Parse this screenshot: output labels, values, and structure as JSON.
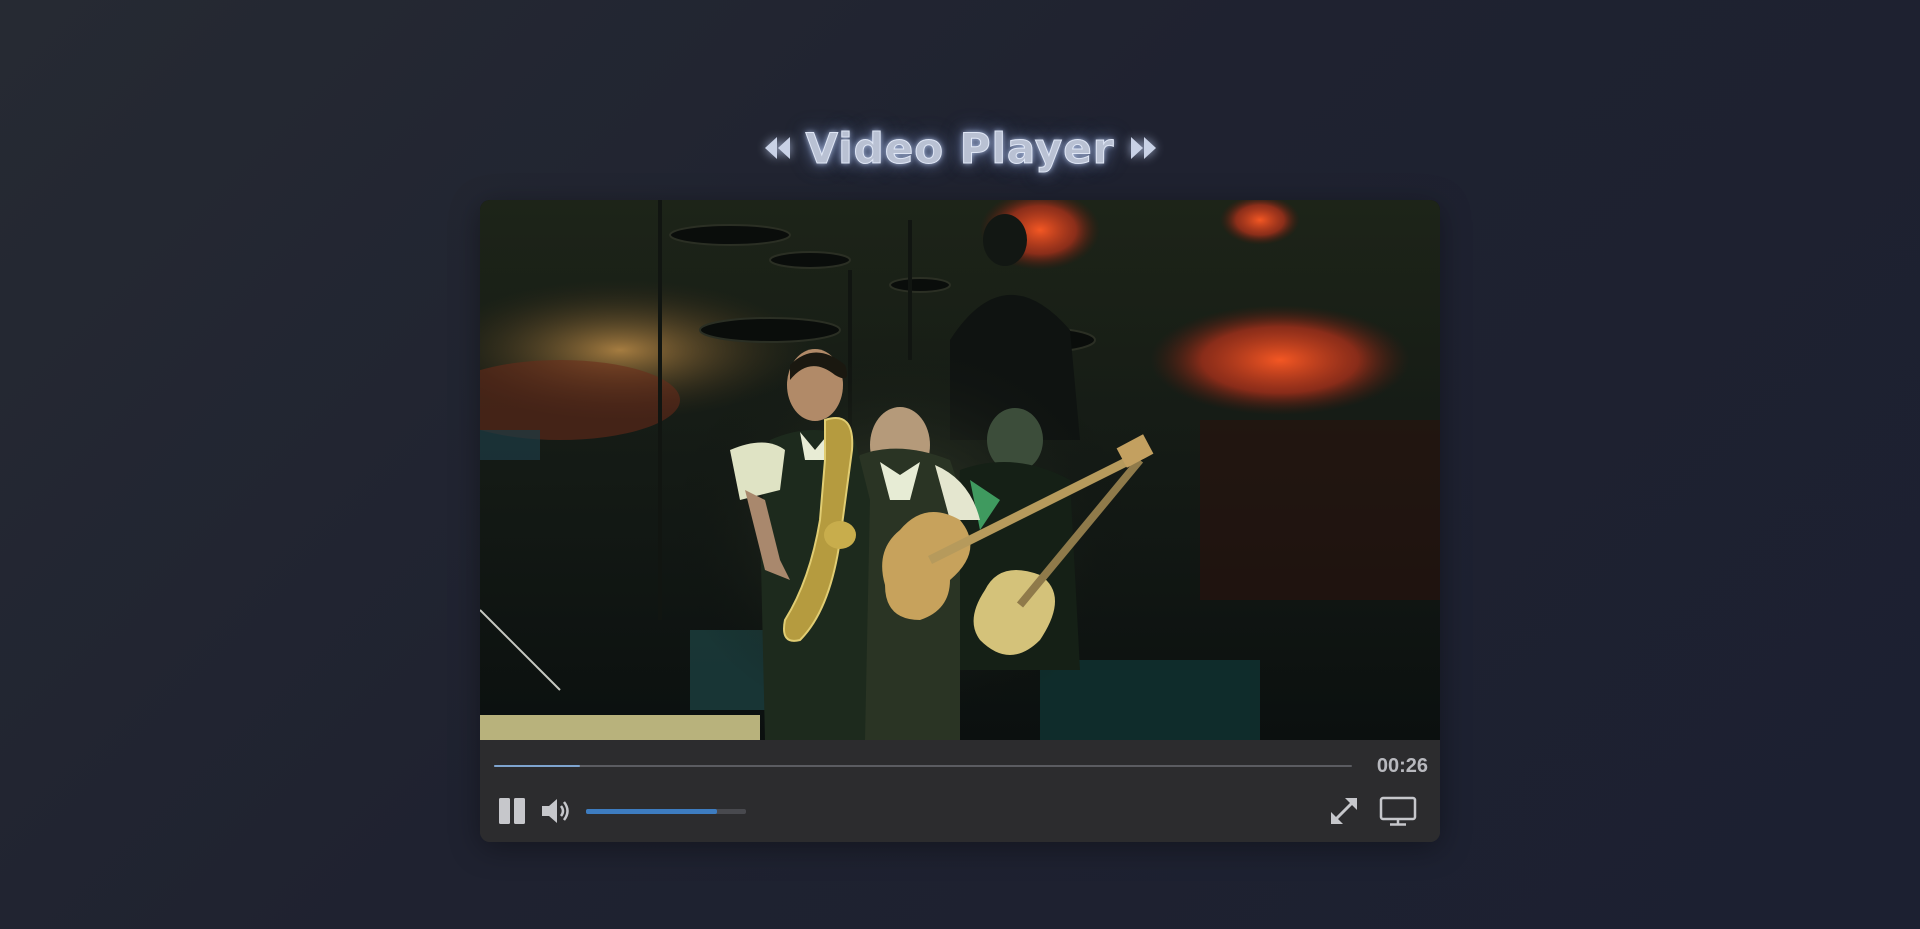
{
  "page": {
    "title": "Video Player",
    "title_left_icon": "rewind-icon",
    "title_right_icon": "fast-forward-icon"
  },
  "player": {
    "current_time": "00:26",
    "progress_fraction": 0.1,
    "volume_fraction": 0.82,
    "buttons": {
      "pause": "pause-icon",
      "volume": "volume-icon",
      "fullscreen": "expand-icon",
      "cast": "monitor-icon"
    }
  },
  "colors": {
    "progress": "#7ea4cf",
    "volume": "#3d7cc0",
    "controls_bg": "#2c2c2e",
    "time_text": "#b8b9be"
  }
}
